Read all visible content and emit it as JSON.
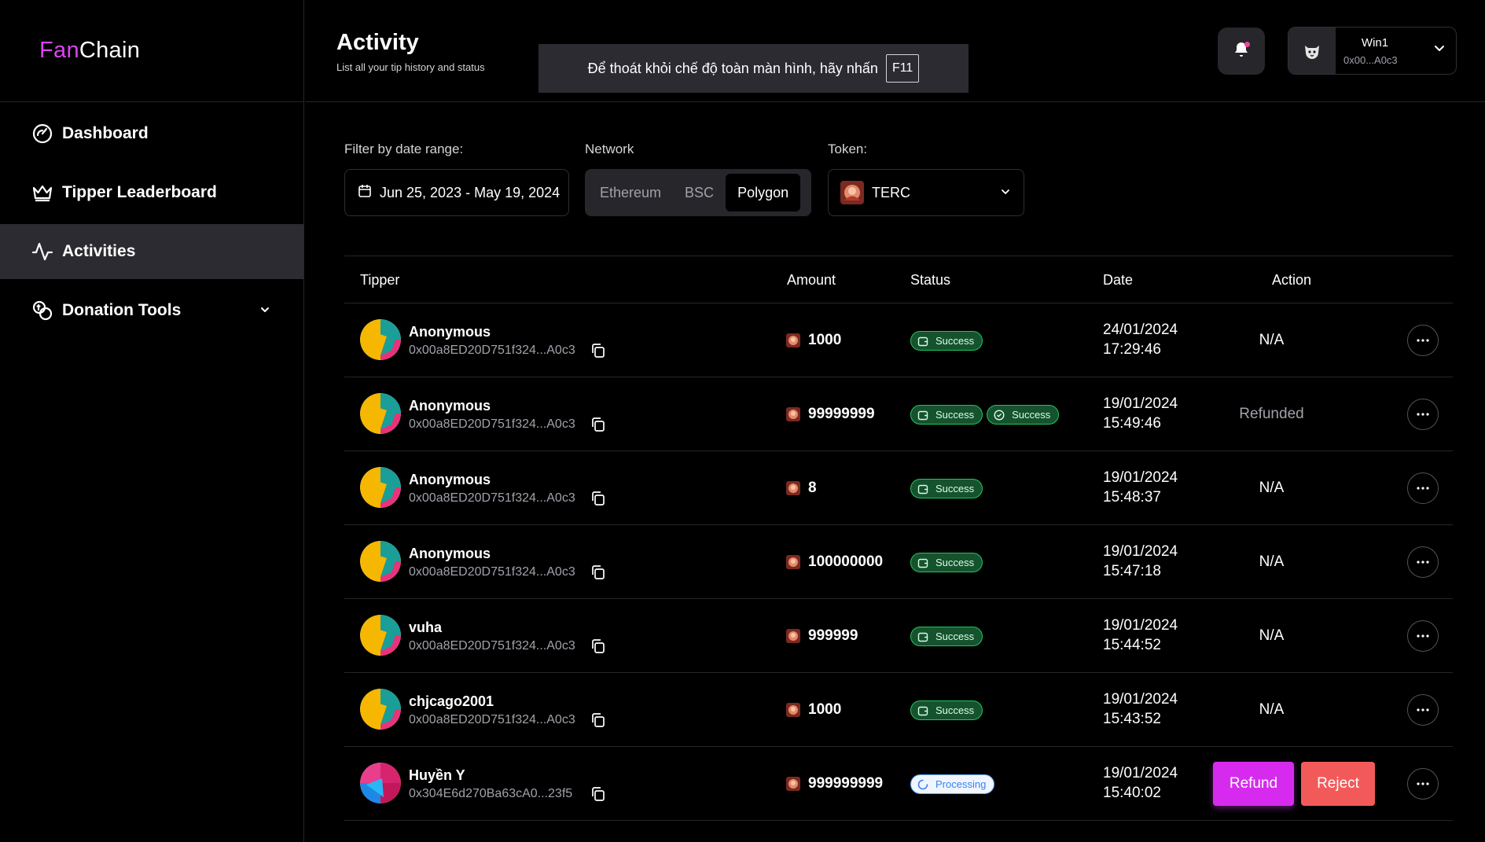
{
  "brand": {
    "part1": "Fan",
    "part2": "Chain",
    "color_primary": "#d946ef"
  },
  "sidebar": {
    "items": [
      {
        "label": "Dashboard",
        "icon": "gauge-icon"
      },
      {
        "label": "Tipper Leaderboard",
        "icon": "crown-icon"
      },
      {
        "label": "Activities",
        "icon": "activity-icon",
        "active": true
      },
      {
        "label": "Donation Tools",
        "icon": "coins-icon",
        "has_dropdown": true
      }
    ]
  },
  "header": {
    "title": "Activity",
    "subtitle": "List all your tip history and status",
    "fullscreen_notice": "Để thoát khỏi chế độ toàn màn hình, hãy nhấn",
    "fullscreen_key": "F11",
    "user": {
      "name": "Win1",
      "address": "0x00...A0c3"
    }
  },
  "filters": {
    "date_label": "Filter by date range:",
    "date_value": "Jun 25, 2023 - May 19, 2024",
    "network_label": "Network",
    "networks": [
      "Ethereum",
      "BSC",
      "Polygon"
    ],
    "network_selected": "Polygon",
    "token_label": "Token:",
    "token_value": "TERC"
  },
  "table": {
    "headers": {
      "tipper": "Tipper",
      "amount": "Amount",
      "status": "Status",
      "date": "Date",
      "action": "Action"
    },
    "rows": [
      {
        "name": "Anonymous",
        "address": "0x00a8ED20D751f324...A0c3",
        "amount": "1000",
        "statuses": [
          "Success"
        ],
        "date": "24/01/2024",
        "time": "17:29:46",
        "action": "N/A"
      },
      {
        "name": "Anonymous",
        "address": "0x00a8ED20D751f324...A0c3",
        "amount": "99999999",
        "statuses": [
          "Success",
          "Success"
        ],
        "date": "19/01/2024",
        "time": "15:49:46",
        "action": "Refunded"
      },
      {
        "name": "Anonymous",
        "address": "0x00a8ED20D751f324...A0c3",
        "amount": "8",
        "statuses": [
          "Success"
        ],
        "date": "19/01/2024",
        "time": "15:48:37",
        "action": "N/A"
      },
      {
        "name": "Anonymous",
        "address": "0x00a8ED20D751f324...A0c3",
        "amount": "100000000",
        "statuses": [
          "Success"
        ],
        "date": "19/01/2024",
        "time": "15:47:18",
        "action": "N/A"
      },
      {
        "name": "vuha",
        "address": "0x00a8ED20D751f324...A0c3",
        "amount": "999999",
        "statuses": [
          "Success"
        ],
        "date": "19/01/2024",
        "time": "15:44:52",
        "action": "N/A"
      },
      {
        "name": "chjcago2001",
        "address": "0x00a8ED20D751f324...A0c3",
        "amount": "1000",
        "statuses": [
          "Success"
        ],
        "date": "19/01/2024",
        "time": "15:43:52",
        "action": "N/A"
      },
      {
        "name": "Huyền Y",
        "address": "0x304E6d270Ba63cA0...23f5",
        "amount": "999999999",
        "statuses": [
          "Processing"
        ],
        "date": "19/01/2024",
        "time": "15:40:02",
        "action_buttons": [
          "Refund",
          "Reject"
        ]
      }
    ]
  }
}
